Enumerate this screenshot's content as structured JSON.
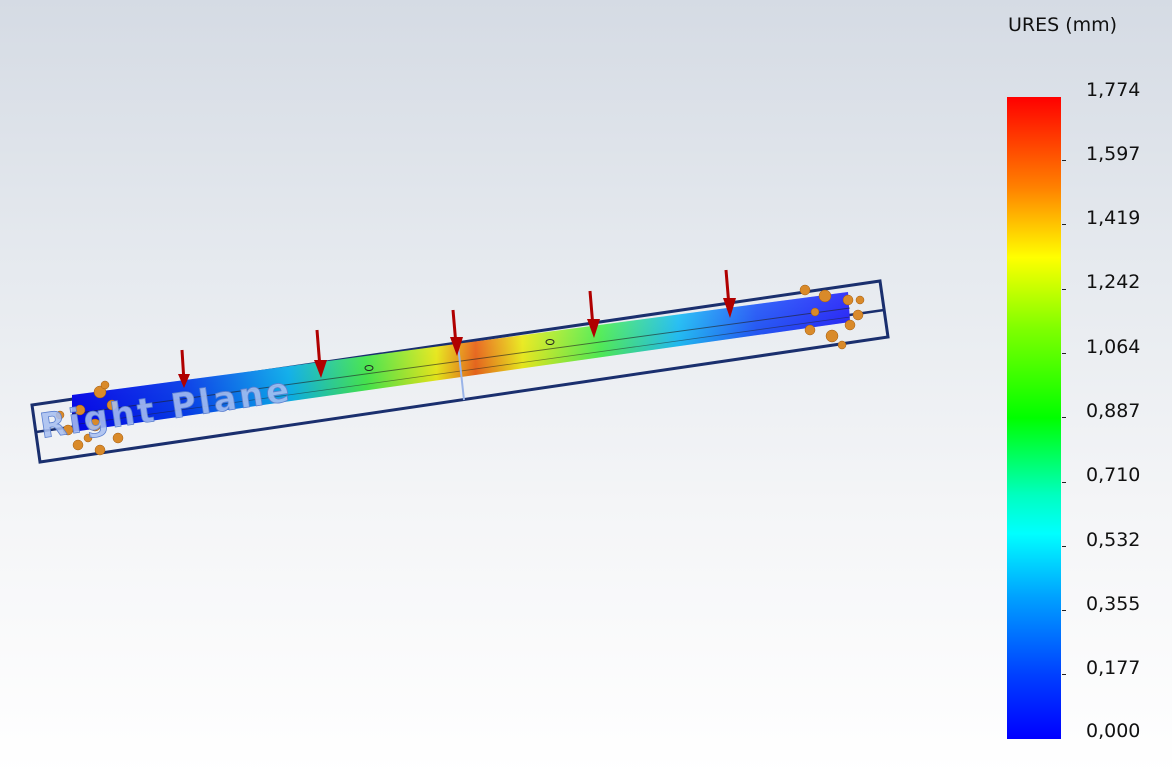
{
  "legend": {
    "title": "URES (mm)",
    "ticks": [
      "1,774",
      "1,597",
      "1,419",
      "1,242",
      "1,064",
      "0,887",
      "0,710",
      "0,532",
      "0,355",
      "0,177",
      "0,000"
    ],
    "colors": [
      "#ff0000",
      "#ff8000",
      "#ffff00",
      "#80ff00",
      "#00ff00",
      "#00ffc0",
      "#00ffff",
      "#00a0ff",
      "#0040ff",
      "#0000ff"
    ]
  },
  "model": {
    "plane_label": "Right Plane",
    "plane_color": "#1a2f6e",
    "load_arrow_color": "#b00000",
    "fixture_color": "#d98a2a",
    "load_arrow_count": 5,
    "fixture_count": 2
  }
}
